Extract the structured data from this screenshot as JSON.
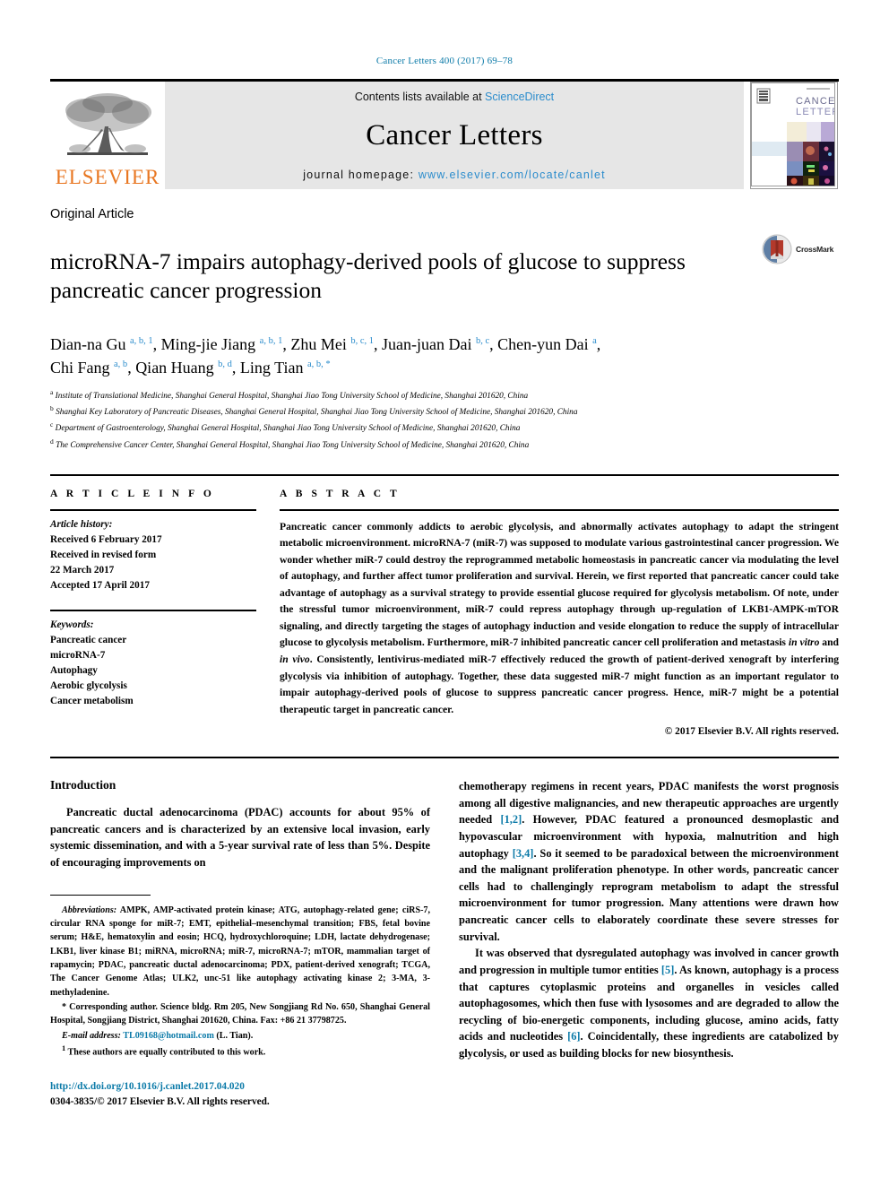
{
  "running_head": "Cancer Letters 400 (2017) 69–78",
  "masthead": {
    "publisher_wordmark": "ELSEVIER",
    "contents_prefix": "Contents lists available at ",
    "contents_link": "ScienceDirect",
    "journal_name": "Cancer Letters",
    "homepage_prefix": "journal homepage: ",
    "homepage_url": "www.elsevier.com/locate/canlet",
    "cover_title_line1": "CANCER",
    "cover_title_line2": "LETTERS",
    "link_color": "#2b8ccc",
    "band_color": "#e6e6e6"
  },
  "article": {
    "type": "Original Article",
    "title": "microRNA-7 impairs autophagy-derived pools of glucose to suppress pancreatic cancer progression",
    "crossmark_label": "CrossMark",
    "authors_line1": "Dian-na Gu a, b, 1, Ming-jie Jiang a, b, 1, Zhu Mei b, c, 1, Juan-juan Dai b, c, Chen-yun Dai a,",
    "authors_line2": "Chi Fang a, b, Qian Huang b, d, Ling Tian a, b, *",
    "authors": [
      {
        "name": "Dian-na Gu",
        "sups": "a, b, 1"
      },
      {
        "name": "Ming-jie Jiang",
        "sups": "a, b, 1"
      },
      {
        "name": "Zhu Mei",
        "sups": "b, c, 1"
      },
      {
        "name": "Juan-juan Dai",
        "sups": "b, c"
      },
      {
        "name": "Chen-yun Dai",
        "sups": "a"
      },
      {
        "name": "Chi Fang",
        "sups": "a, b"
      },
      {
        "name": "Qian Huang",
        "sups": "b, d"
      },
      {
        "name": "Ling Tian",
        "sups": "a, b, *"
      }
    ],
    "affiliations": [
      {
        "marker": "a",
        "text": "Institute of Translational Medicine, Shanghai General Hospital, Shanghai Jiao Tong University School of Medicine, Shanghai 201620, China"
      },
      {
        "marker": "b",
        "text": "Shanghai Key Laboratory of Pancreatic Diseases, Shanghai General Hospital, Shanghai Jiao Tong University School of Medicine, Shanghai 201620, China"
      },
      {
        "marker": "c",
        "text": "Department of Gastroenterology, Shanghai General Hospital, Shanghai Jiao Tong University School of Medicine, Shanghai 201620, China"
      },
      {
        "marker": "d",
        "text": "The Comprehensive Cancer Center, Shanghai General Hospital, Shanghai Jiao Tong University School of Medicine, Shanghai 201620, China"
      }
    ]
  },
  "article_info": {
    "heading": "A R T I C L E   I N F O",
    "history_label": "Article history:",
    "history": [
      "Received 6 February 2017",
      "Received in revised form",
      "22 March 2017",
      "Accepted 17 April 2017"
    ],
    "keywords_label": "Keywords:",
    "keywords": [
      "Pancreatic cancer",
      "microRNA-7",
      "Autophagy",
      "Aerobic glycolysis",
      "Cancer metabolism"
    ]
  },
  "abstract": {
    "heading": "A B S T R A C T",
    "part1": "Pancreatic cancer commonly addicts to aerobic glycolysis, and abnormally activates autophagy to adapt the stringent metabolic microenvironment. microRNA-7 (miR-7) was supposed to modulate various gastrointestinal cancer progression. We wonder whether miR-7 could destroy the reprogrammed metabolic homeostasis in pancreatic cancer via modulating the level of autophagy, and further affect tumor proliferation and survival. Herein, we first reported that pancreatic cancer could take advantage of autophagy as a survival strategy to provide essential glucose required for glycolysis metabolism. Of note, under the stressful tumor microenvironment, miR-7 could repress autophagy through up-regulation of LKB1-AMPK-mTOR signaling, and directly targeting the stages of autophagy induction and veside elongation to reduce the supply of intracellular glucose to glycolysis metabolism. Furthermore, miR-7 inhibited pancreatic cancer cell proliferation and metastasis ",
    "italic1": "in vitro",
    "mid1": " and ",
    "italic2": "in vivo",
    "part2": ". Consistently, lentivirus-mediated miR-7 effectively reduced the growth of patient-derived xenograft by interfering glycolysis via inhibition of autophagy. Together, these data suggested miR-7 might function as an important regulator to impair autophagy-derived pools of glucose to suppress pancreatic cancer progress. Hence, miR-7 might be a potential therapeutic target in pancreatic cancer.",
    "copyright": "© 2017 Elsevier B.V. All rights reserved."
  },
  "body": {
    "intro_heading": "Introduction",
    "left_para1": "Pancreatic ductal adenocarcinoma (PDAC) accounts for about 95% of pancreatic cancers and is characterized by an extensive local invasion, early systemic dissemination, and with a 5-year survival rate of less than 5%. Despite of encouraging improvements on",
    "right_para1_a": "chemotherapy regimens in recent years, PDAC manifests the worst prognosis among all digestive malignancies, and new therapeutic approaches are urgently needed ",
    "right_ref1": "[1,2]",
    "right_para1_b": ". However, PDAC featured a pronounced desmoplastic and hypovascular microenvironment with hypoxia, malnutrition and high autophagy ",
    "right_ref2": "[3,4]",
    "right_para1_c": ". So it seemed to be paradoxical between the microenvironment and the malignant proliferation phenotype. In other words, pancreatic cancer cells had to challengingly reprogram metabolism to adapt the stressful microenvironment for tumor progression. Many attentions were drawn how pancreatic cancer cells to elaborately coordinate these severe stresses for survival.",
    "right_para2_a": "It was observed that dysregulated autophagy was involved in cancer growth and progression in multiple tumor entities ",
    "right_ref3": "[5]",
    "right_para2_b": ". As known, autophagy is a process that captures cytoplasmic proteins and organelles in vesicles called autophagosomes, which then fuse with lysosomes and are degraded to allow the recycling of bio-energetic components, including glucose, amino acids, fatty acids and nucleotides ",
    "right_ref4": "[6]",
    "right_para2_c": ". Coincidentally, these ingredients are catabolized by glycolysis, or used as building blocks for new biosynthesis."
  },
  "footnotes": {
    "abbrev_label": "Abbreviations:",
    "abbrev_text": " AMPK, AMP-activated protein kinase; ATG, autophagy-related gene; ciRS-7, circular RNA sponge for miR-7; EMT, epithelial–mesenchymal transition; FBS, fetal bovine serum; H&E, hematoxylin and eosin; HCQ, hydroxychloroquine; LDH, lactate dehydrogenase; LKB1, liver kinase B1; miRNA, microRNA; miR-7, microRNA-7; mTOR, mammalian target of rapamycin; PDAC, pancreatic ductal adenocarcinoma; PDX, patient-derived xenograft; TCGA, The Cancer Genome Atlas; ULK2, unc-51 like autophagy activating kinase 2; 3-MA, 3-methyladenine.",
    "corresponding": "* Corresponding author. Science bldg. Rm 205, New Songjiang Rd No. 650, Shanghai General Hospital, Songjiang District, Shanghai 201620, China. Fax: +86 21 37798725.",
    "email_label": "E-mail address:",
    "email": "TL09168@hotmail.com",
    "email_suffix": " (L. Tian).",
    "equal_contrib_marker": "1",
    "equal_contrib": " These authors are equally contributed to this work.",
    "doi": "http://dx.doi.org/10.1016/j.canlet.2017.04.020",
    "issn_line": "0304-3835/© 2017 Elsevier B.V. All rights reserved."
  }
}
